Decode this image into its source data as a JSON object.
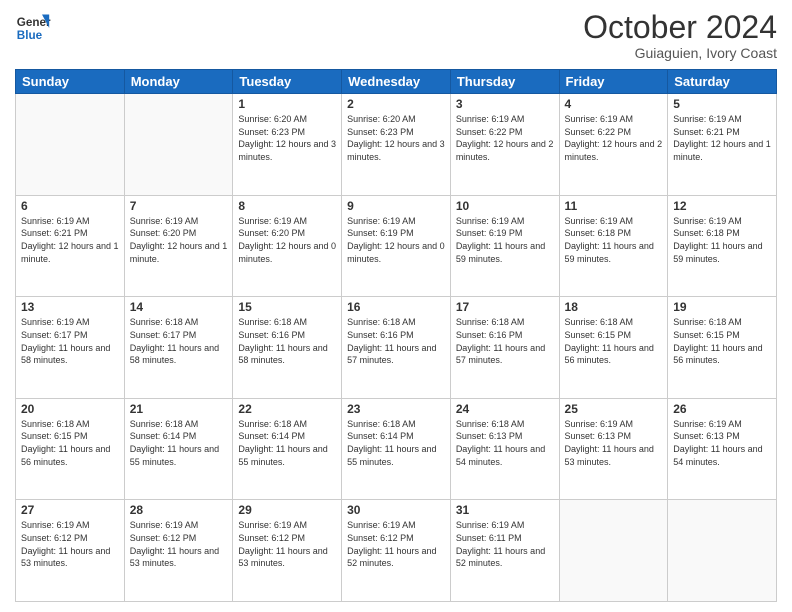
{
  "logo": {
    "line1": "General",
    "line2": "Blue"
  },
  "title": "October 2024",
  "subtitle": "Guiaguien, Ivory Coast",
  "days_of_week": [
    "Sunday",
    "Monday",
    "Tuesday",
    "Wednesday",
    "Thursday",
    "Friday",
    "Saturday"
  ],
  "weeks": [
    [
      {
        "day": "",
        "info": ""
      },
      {
        "day": "",
        "info": ""
      },
      {
        "day": "1",
        "info": "Sunrise: 6:20 AM\nSunset: 6:23 PM\nDaylight: 12 hours and 3 minutes."
      },
      {
        "day": "2",
        "info": "Sunrise: 6:20 AM\nSunset: 6:23 PM\nDaylight: 12 hours and 3 minutes."
      },
      {
        "day": "3",
        "info": "Sunrise: 6:19 AM\nSunset: 6:22 PM\nDaylight: 12 hours and 2 minutes."
      },
      {
        "day": "4",
        "info": "Sunrise: 6:19 AM\nSunset: 6:22 PM\nDaylight: 12 hours and 2 minutes."
      },
      {
        "day": "5",
        "info": "Sunrise: 6:19 AM\nSunset: 6:21 PM\nDaylight: 12 hours and 1 minute."
      }
    ],
    [
      {
        "day": "6",
        "info": "Sunrise: 6:19 AM\nSunset: 6:21 PM\nDaylight: 12 hours and 1 minute."
      },
      {
        "day": "7",
        "info": "Sunrise: 6:19 AM\nSunset: 6:20 PM\nDaylight: 12 hours and 1 minute."
      },
      {
        "day": "8",
        "info": "Sunrise: 6:19 AM\nSunset: 6:20 PM\nDaylight: 12 hours and 0 minutes."
      },
      {
        "day": "9",
        "info": "Sunrise: 6:19 AM\nSunset: 6:19 PM\nDaylight: 12 hours and 0 minutes."
      },
      {
        "day": "10",
        "info": "Sunrise: 6:19 AM\nSunset: 6:19 PM\nDaylight: 11 hours and 59 minutes."
      },
      {
        "day": "11",
        "info": "Sunrise: 6:19 AM\nSunset: 6:18 PM\nDaylight: 11 hours and 59 minutes."
      },
      {
        "day": "12",
        "info": "Sunrise: 6:19 AM\nSunset: 6:18 PM\nDaylight: 11 hours and 59 minutes."
      }
    ],
    [
      {
        "day": "13",
        "info": "Sunrise: 6:19 AM\nSunset: 6:17 PM\nDaylight: 11 hours and 58 minutes."
      },
      {
        "day": "14",
        "info": "Sunrise: 6:18 AM\nSunset: 6:17 PM\nDaylight: 11 hours and 58 minutes."
      },
      {
        "day": "15",
        "info": "Sunrise: 6:18 AM\nSunset: 6:16 PM\nDaylight: 11 hours and 58 minutes."
      },
      {
        "day": "16",
        "info": "Sunrise: 6:18 AM\nSunset: 6:16 PM\nDaylight: 11 hours and 57 minutes."
      },
      {
        "day": "17",
        "info": "Sunrise: 6:18 AM\nSunset: 6:16 PM\nDaylight: 11 hours and 57 minutes."
      },
      {
        "day": "18",
        "info": "Sunrise: 6:18 AM\nSunset: 6:15 PM\nDaylight: 11 hours and 56 minutes."
      },
      {
        "day": "19",
        "info": "Sunrise: 6:18 AM\nSunset: 6:15 PM\nDaylight: 11 hours and 56 minutes."
      }
    ],
    [
      {
        "day": "20",
        "info": "Sunrise: 6:18 AM\nSunset: 6:15 PM\nDaylight: 11 hours and 56 minutes."
      },
      {
        "day": "21",
        "info": "Sunrise: 6:18 AM\nSunset: 6:14 PM\nDaylight: 11 hours and 55 minutes."
      },
      {
        "day": "22",
        "info": "Sunrise: 6:18 AM\nSunset: 6:14 PM\nDaylight: 11 hours and 55 minutes."
      },
      {
        "day": "23",
        "info": "Sunrise: 6:18 AM\nSunset: 6:14 PM\nDaylight: 11 hours and 55 minutes."
      },
      {
        "day": "24",
        "info": "Sunrise: 6:18 AM\nSunset: 6:13 PM\nDaylight: 11 hours and 54 minutes."
      },
      {
        "day": "25",
        "info": "Sunrise: 6:19 AM\nSunset: 6:13 PM\nDaylight: 11 hours and 53 minutes."
      },
      {
        "day": "26",
        "info": "Sunrise: 6:19 AM\nSunset: 6:13 PM\nDaylight: 11 hours and 54 minutes."
      }
    ],
    [
      {
        "day": "27",
        "info": "Sunrise: 6:19 AM\nSunset: 6:12 PM\nDaylight: 11 hours and 53 minutes."
      },
      {
        "day": "28",
        "info": "Sunrise: 6:19 AM\nSunset: 6:12 PM\nDaylight: 11 hours and 53 minutes."
      },
      {
        "day": "29",
        "info": "Sunrise: 6:19 AM\nSunset: 6:12 PM\nDaylight: 11 hours and 53 minutes."
      },
      {
        "day": "30",
        "info": "Sunrise: 6:19 AM\nSunset: 6:12 PM\nDaylight: 11 hours and 52 minutes."
      },
      {
        "day": "31",
        "info": "Sunrise: 6:19 AM\nSunset: 6:11 PM\nDaylight: 11 hours and 52 minutes."
      },
      {
        "day": "",
        "info": ""
      },
      {
        "day": "",
        "info": ""
      }
    ]
  ]
}
